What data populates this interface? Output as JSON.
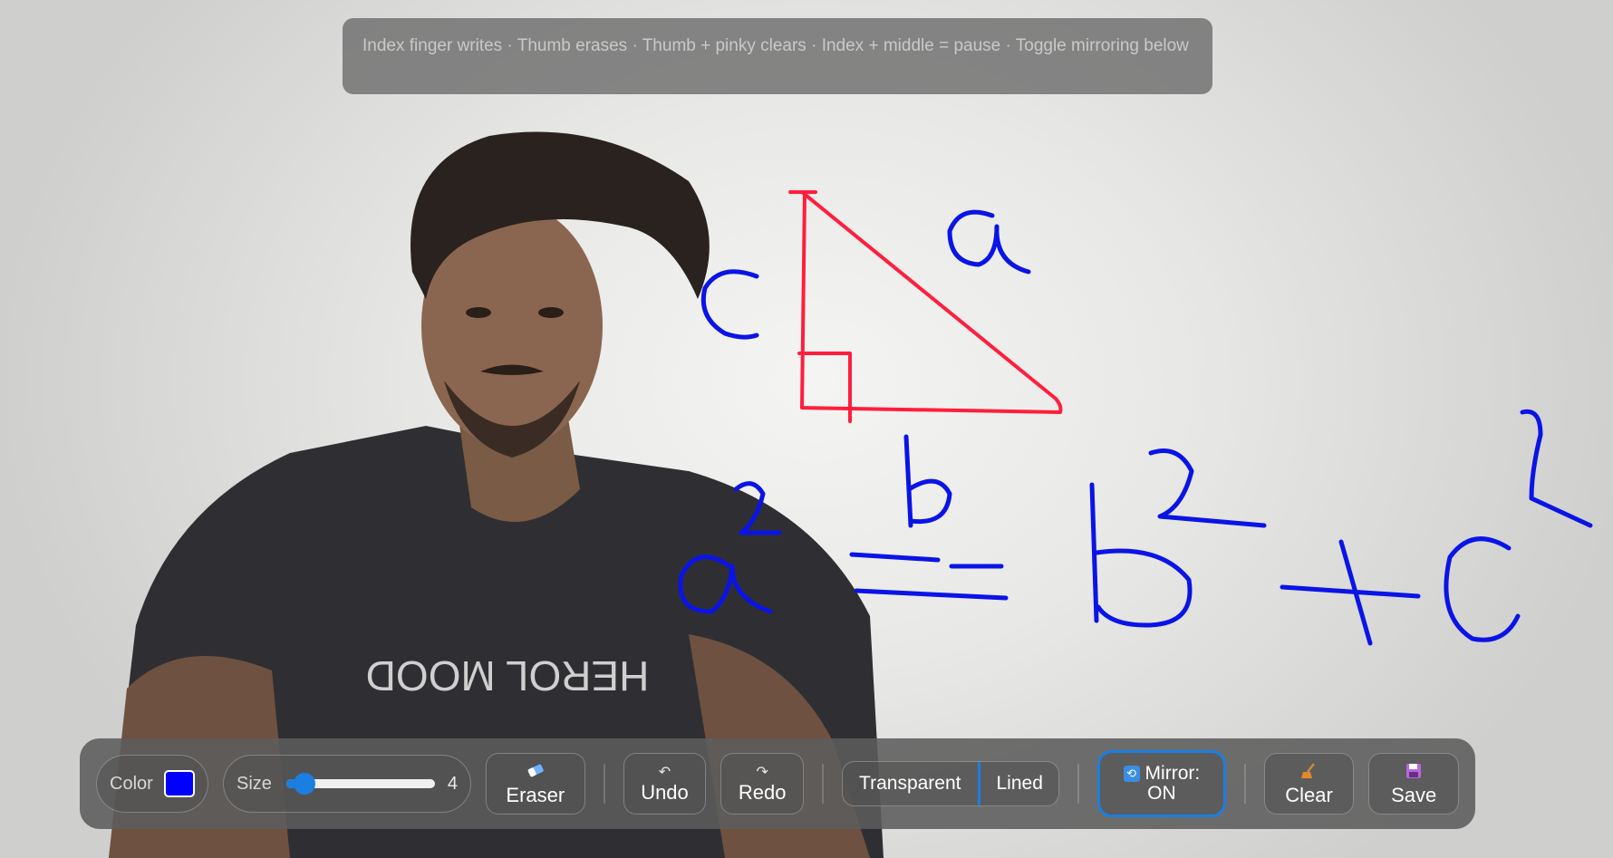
{
  "hint": {
    "text": "Index finger writes · Thumb erases · Thumb + pinky clears · Index + middle = pause · Toggle mirroring below"
  },
  "toolbar": {
    "color_label": "Color",
    "color_value": "#0000ff",
    "size_label": "Size",
    "size_value": "4",
    "size_fraction": 0.12,
    "eraser_label": "Eraser",
    "eraser_icon": "eraser-icon",
    "undo_label": "Undo",
    "undo_icon": "undo-icon",
    "redo_label": "Redo",
    "redo_icon": "redo-icon",
    "background_options": [
      "Transparent",
      "Lined"
    ],
    "mirror_label": "Mirror:",
    "mirror_state": "ON",
    "mirror_icon": "mirror-icon",
    "clear_label": "Clear",
    "clear_icon": "broom-icon",
    "save_label": "Save",
    "save_icon": "floppy-disk-icon"
  },
  "colors": {
    "accent": "#1a7fe0",
    "ink_red": "#ff1e3c",
    "ink_blue": "#0a14e6"
  }
}
